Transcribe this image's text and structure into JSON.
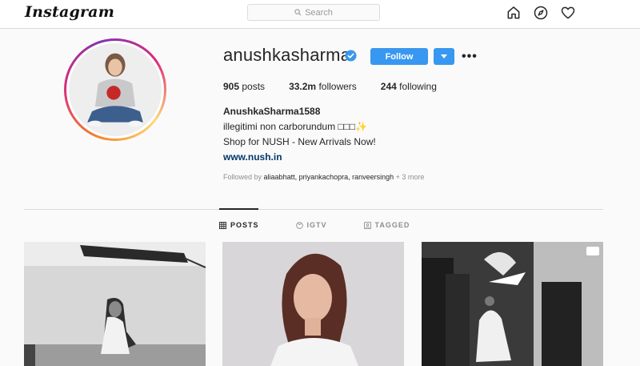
{
  "app": {
    "logo": "Instagram"
  },
  "search": {
    "placeholder": "Search"
  },
  "nav": {
    "icons": [
      "home-icon",
      "compass-icon",
      "heart-icon"
    ]
  },
  "profile": {
    "username": "anushkasharma",
    "verified": true,
    "follow_label": "Follow",
    "stats": {
      "posts_count": "905",
      "posts_label": "posts",
      "followers_count": "33.2m",
      "followers_label": "followers",
      "following_count": "244",
      "following_label": "following"
    },
    "full_name": "AnushkaSharma1588",
    "bio_line1": "illegitimi non carborundum □□□✨",
    "bio_line2": "Shop for NUSH - New Arrivals Now!",
    "website": "www.nush.in",
    "followed_by_prefix": "Followed by",
    "followed_by_names": "aliaabhatt, priyankachopra, ranveersingh",
    "followed_by_more": "+ 3 more"
  },
  "tabs": [
    {
      "label": "POSTS",
      "icon": "grid-icon",
      "active": true
    },
    {
      "label": "IGTV",
      "icon": "igtv-icon",
      "active": false
    },
    {
      "label": "TAGGED",
      "icon": "tagged-icon",
      "active": false
    }
  ],
  "colors": {
    "accent": "#3897f0",
    "link": "#00376b",
    "text": "#262626",
    "muted": "#8e8e8e"
  }
}
